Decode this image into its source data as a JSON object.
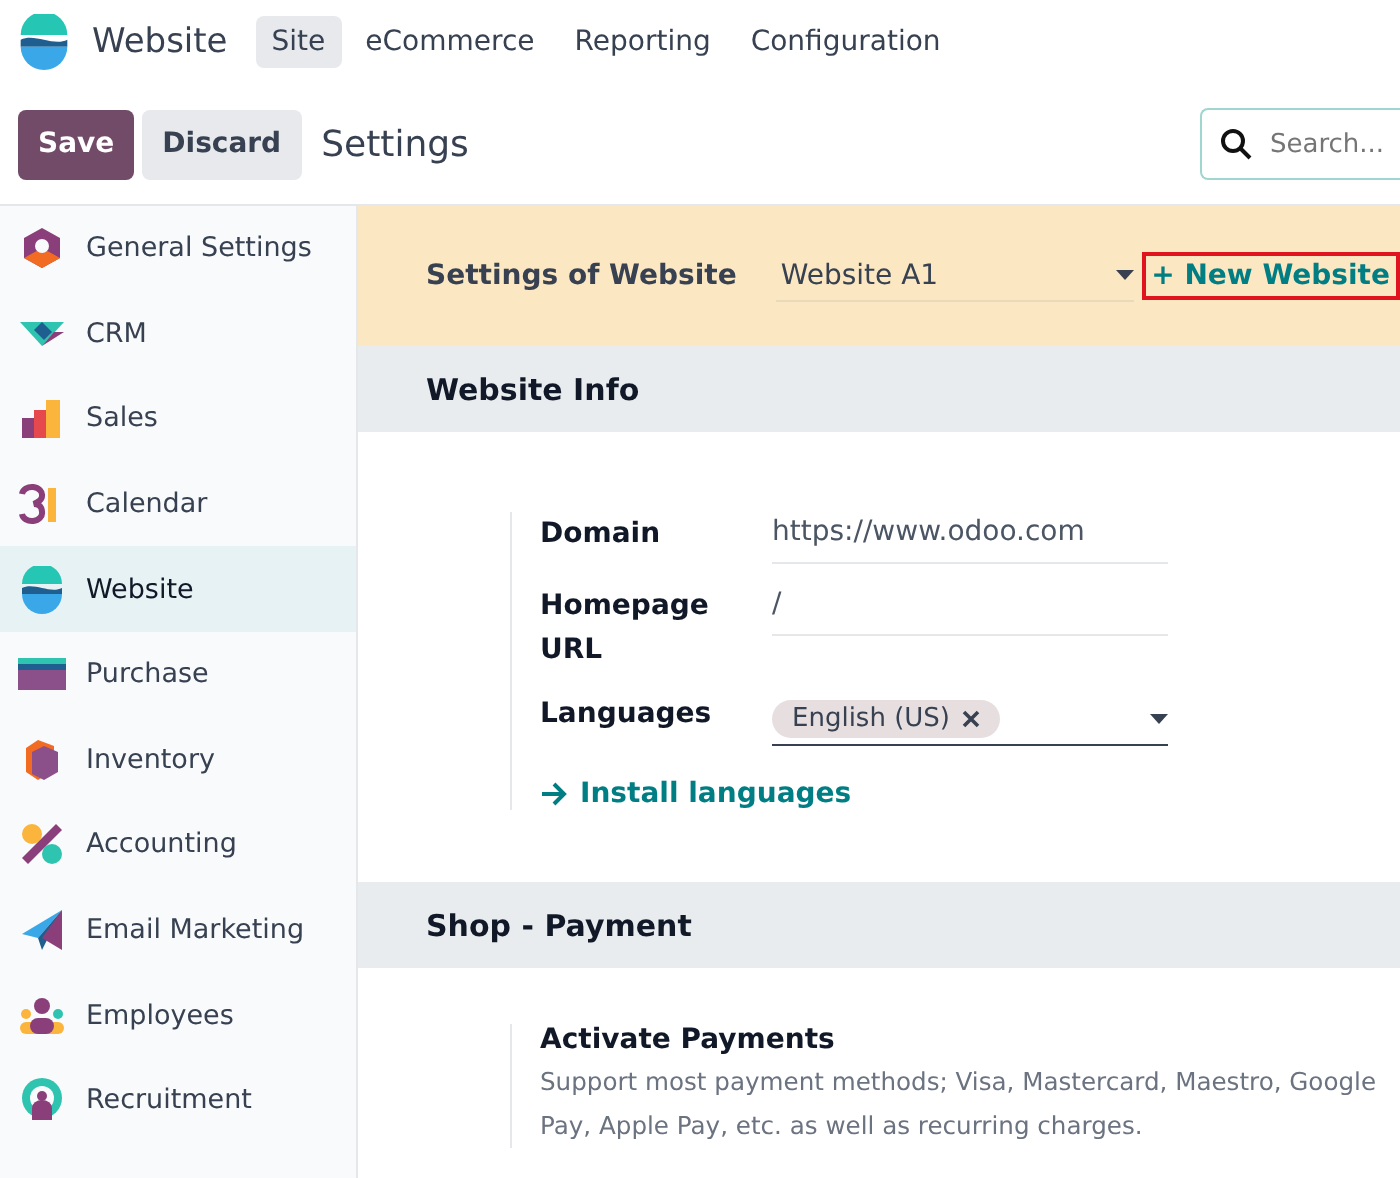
{
  "app": {
    "name": "Website"
  },
  "menu": [
    {
      "label": "Site",
      "selected": true
    },
    {
      "label": "eCommerce",
      "selected": false
    },
    {
      "label": "Reporting",
      "selected": false
    },
    {
      "label": "Configuration",
      "selected": false
    }
  ],
  "control_bar": {
    "save": "Save",
    "discard": "Discard",
    "title": "Settings",
    "search": {
      "placeholder": "Search..."
    }
  },
  "sidebar": {
    "items": [
      {
        "label": "General Settings",
        "selected": false
      },
      {
        "label": "CRM",
        "selected": false
      },
      {
        "label": "Sales",
        "selected": false
      },
      {
        "label": "Calendar",
        "selected": false
      },
      {
        "label": "Website",
        "selected": true
      },
      {
        "label": "Purchase",
        "selected": false
      },
      {
        "label": "Inventory",
        "selected": false
      },
      {
        "label": "Accounting",
        "selected": false
      },
      {
        "label": "Email Marketing",
        "selected": false
      },
      {
        "label": "Employees",
        "selected": false
      },
      {
        "label": "Recruitment",
        "selected": false
      }
    ]
  },
  "website_banner": {
    "label": "Settings of Website",
    "value": "Website A1",
    "new_website": {
      "label": "+ New Website",
      "highlighted": true
    }
  },
  "website_info": {
    "title": "Website Info",
    "fields": [
      {
        "label": "Domain",
        "value": "https://www.odoo.com"
      },
      {
        "label": "Homepage URL",
        "value": "/"
      }
    ],
    "languages": {
      "label": "Languages",
      "tags": [
        "English (US)"
      ]
    },
    "install_link": "Install languages"
  },
  "shop_payment": {
    "title": "Shop - Payment",
    "setting": {
      "title": "Activate Payments",
      "description": "Support most payment methods; Visa, Mastercard, Maestro, Google Pay, Apple Pay, etc. as well as recurring charges."
    }
  }
}
